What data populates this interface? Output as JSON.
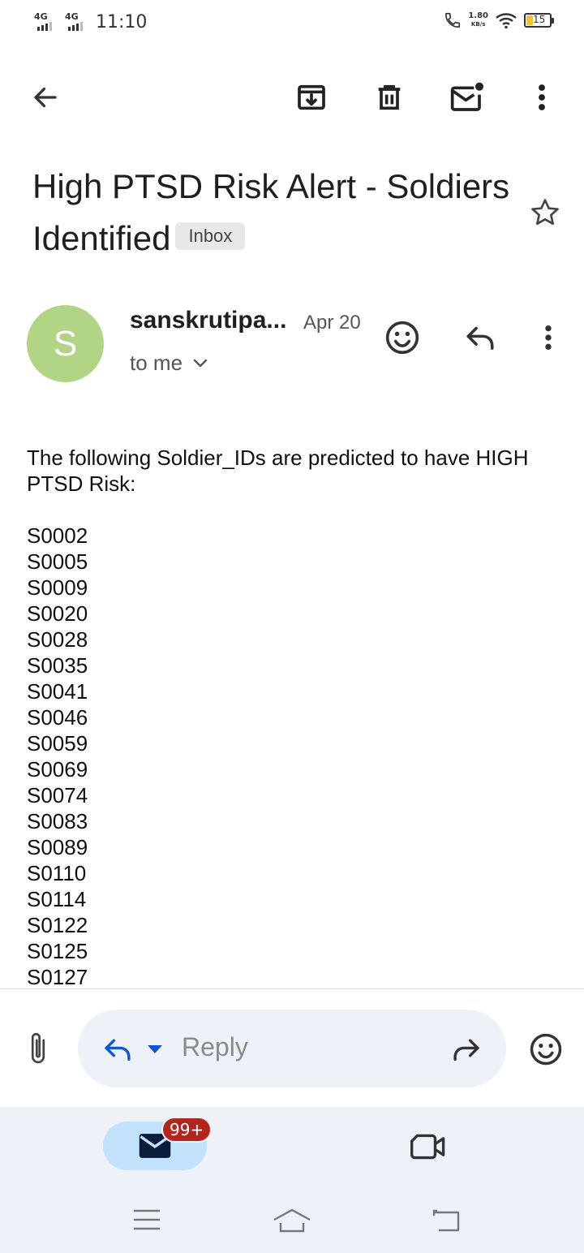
{
  "status_bar": {
    "signal_1": "4G",
    "signal_2": "4G",
    "time": "11:10",
    "net_speed": "1.80",
    "net_speed_unit": "KB/s",
    "battery": "15"
  },
  "toolbar": {
    "back_icon": "arrow-left-icon",
    "archive_icon": "archive-icon",
    "delete_icon": "trash-icon",
    "mark_unread_icon": "mail-unread-icon",
    "more_icon": "more-vertical-icon"
  },
  "subject": {
    "text": "High PTSD Risk Alert - Soldiers Identified",
    "label": "Inbox",
    "star_icon": "star-outline-icon"
  },
  "sender": {
    "avatar_letter": "S",
    "avatar_color": "#b2d585",
    "name": "sanskrutipa...",
    "date": "Apr 20",
    "recipient": "to me"
  },
  "body": {
    "intro": "The following Soldier_IDs are predicted to have HIGH PTSD Risk:",
    "soldier_ids": [
      "S0002",
      "S0005",
      "S0009",
      "S0020",
      "S0028",
      "S0035",
      "S0041",
      "S0046",
      "S0059",
      "S0069",
      "S0074",
      "S0083",
      "S0089",
      "S0110",
      "S0114",
      "S0122",
      "S0125",
      "S0127"
    ]
  },
  "reply_bar": {
    "placeholder": "Reply"
  },
  "bottom_nav": {
    "mail_badge": "99+",
    "accent": "#c2e1fa",
    "badge_color": "#b3261e"
  },
  "colors": {
    "background": "#ffffff",
    "nav_background": "#eef2f8",
    "link_blue": "#0b57d0"
  }
}
